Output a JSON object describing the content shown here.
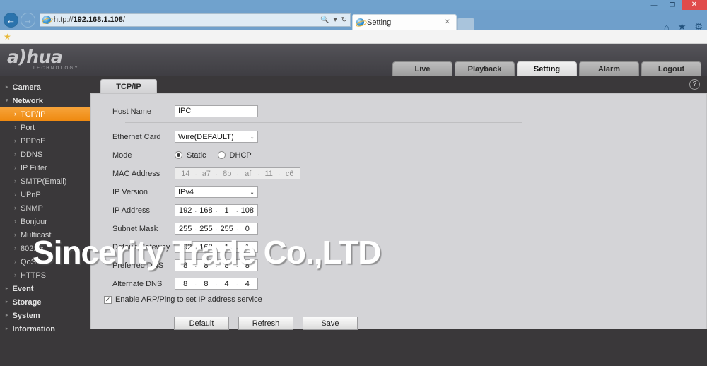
{
  "browser": {
    "window_controls": {
      "minimize": "—",
      "maximize": "❐",
      "close": "✕"
    },
    "back_arrow": "←",
    "forward_arrow": "→",
    "url_protocol": "http://",
    "url_host": "192.168.1.108",
    "url_path": "/",
    "search_glyph": "🔍",
    "dropdown_glyph": "▾",
    "refresh_glyph": "↻",
    "tab_title": "Setting",
    "tab_close": "✕",
    "home_glyph": "⌂",
    "favorites_glyph": "★",
    "tools_glyph": "⚙",
    "bookmark_star": "★"
  },
  "device": {
    "logo_main": "a)hua",
    "logo_sub": "TECHNOLOGY",
    "nav_tabs": [
      {
        "label": "Live",
        "active": false
      },
      {
        "label": "Playback",
        "active": false
      },
      {
        "label": "Setting",
        "active": true
      },
      {
        "label": "Alarm",
        "active": false
      },
      {
        "label": "Logout",
        "active": false
      }
    ],
    "help_glyph": "?",
    "panel_tab": "TCP/IP"
  },
  "sidebar": {
    "groups": [
      {
        "label": "Camera",
        "caret": "▸",
        "expanded": false,
        "items": []
      },
      {
        "label": "Network",
        "caret": "▾",
        "expanded": true,
        "items": [
          {
            "label": "TCP/IP",
            "arrow": "›",
            "active": true
          },
          {
            "label": "Port",
            "arrow": "›",
            "active": false
          },
          {
            "label": "PPPoE",
            "arrow": "›",
            "active": false
          },
          {
            "label": "DDNS",
            "arrow": "›",
            "active": false
          },
          {
            "label": "IP Filter",
            "arrow": "›",
            "active": false
          },
          {
            "label": "SMTP(Email)",
            "arrow": "›",
            "active": false
          },
          {
            "label": "UPnP",
            "arrow": "›",
            "active": false
          },
          {
            "label": "SNMP",
            "arrow": "›",
            "active": false
          },
          {
            "label": "Bonjour",
            "arrow": "›",
            "active": false
          },
          {
            "label": "Multicast",
            "arrow": "›",
            "active": false
          },
          {
            "label": "802.1x",
            "arrow": "›",
            "active": false
          },
          {
            "label": "QoS",
            "arrow": "›",
            "active": false
          },
          {
            "label": "HTTPS",
            "arrow": "›",
            "active": false
          }
        ]
      },
      {
        "label": "Event",
        "caret": "▸",
        "expanded": false,
        "items": []
      },
      {
        "label": "Storage",
        "caret": "▸",
        "expanded": false,
        "items": []
      },
      {
        "label": "System",
        "caret": "▸",
        "expanded": false,
        "items": []
      },
      {
        "label": "Information",
        "caret": "▸",
        "expanded": false,
        "items": []
      }
    ]
  },
  "form": {
    "host_name": {
      "label": "Host Name",
      "value": "IPC"
    },
    "ethernet_card": {
      "label": "Ethernet Card",
      "value": "Wire(DEFAULT)",
      "chevron": "⌄"
    },
    "mode": {
      "label": "Mode",
      "options": [
        {
          "label": "Static",
          "selected": true
        },
        {
          "label": "DHCP",
          "selected": false
        }
      ]
    },
    "mac_address": {
      "label": "MAC Address",
      "octets": [
        "14",
        "a7",
        "8b",
        "af",
        "11",
        "c6"
      ],
      "readonly": true
    },
    "ip_version": {
      "label": "IP Version",
      "value": "IPv4",
      "chevron": "⌄"
    },
    "ip_address": {
      "label": "IP Address",
      "octets": [
        "192",
        "168",
        "1",
        "108"
      ]
    },
    "subnet_mask": {
      "label": "Subnet Mask",
      "octets": [
        "255",
        "255",
        "255",
        "0"
      ]
    },
    "default_gateway": {
      "label": "Default Gateway",
      "octets": [
        "192",
        "168",
        "1",
        "1"
      ]
    },
    "preferred_dns": {
      "label": "Preferred DNS",
      "octets": [
        "8",
        "8",
        "8",
        "8"
      ]
    },
    "alternate_dns": {
      "label": "Alternate DNS",
      "octets": [
        "8",
        "8",
        "4",
        "4"
      ]
    },
    "arp_ping": {
      "label": "Enable ARP/Ping to set IP address service",
      "checked": true,
      "check_glyph": "✓"
    },
    "separator": ".",
    "buttons": [
      {
        "label": "Default"
      },
      {
        "label": "Refresh"
      },
      {
        "label": "Save"
      }
    ]
  },
  "watermark": {
    "text": "Sincerity Trade Co.,LTD"
  },
  "colors": {
    "accent_orange": "#ef8a10",
    "chrome_blue": "#6f9fcb",
    "panel_gray": "#d4d4d7",
    "dark_bg": "#3a383a",
    "close_red": "#e04b4b"
  }
}
